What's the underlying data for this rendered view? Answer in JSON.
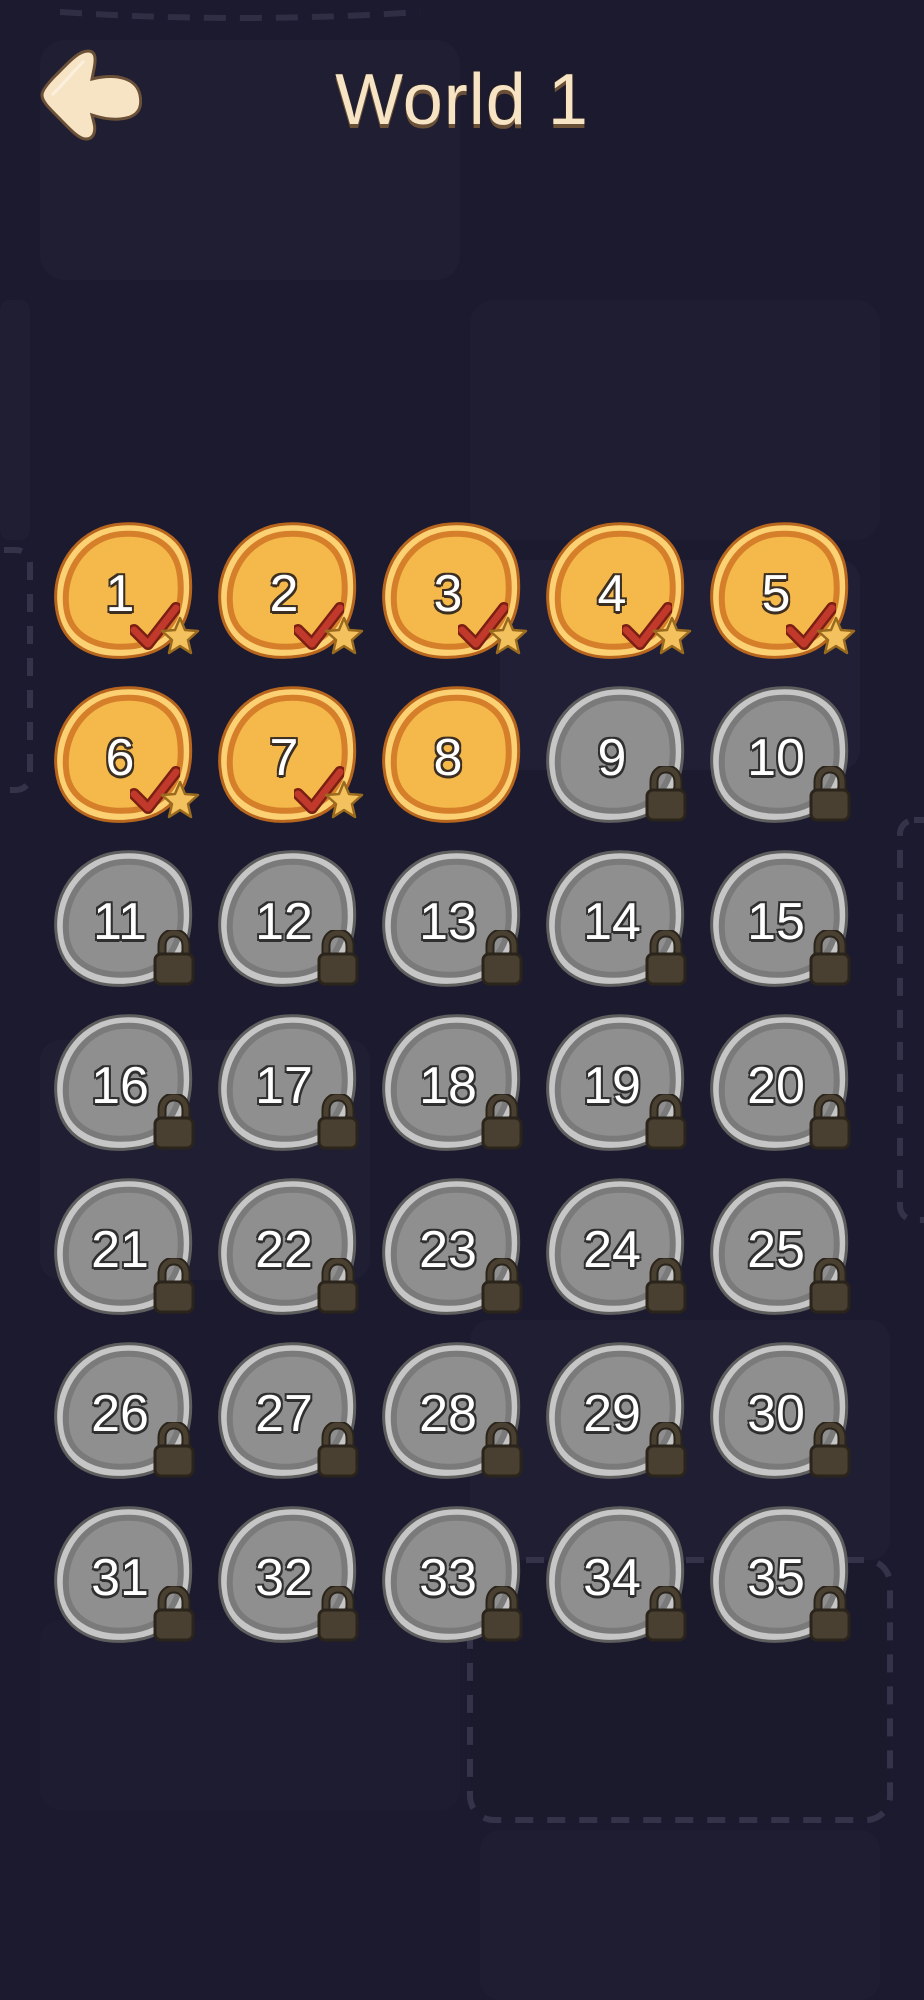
{
  "header": {
    "title": "World 1",
    "back_icon": "back-arrow-icon"
  },
  "colors": {
    "background": "#1b1a2e",
    "unlocked": "#f5b84a",
    "unlocked_rim": "#d67f2a",
    "locked": "#8f8f8f",
    "locked_rim": "#c6c6c6",
    "title": "#f7e4c4",
    "check": "#c0392b",
    "star": "#f3c15d",
    "lock": "#4a4032"
  },
  "levels": [
    {
      "label": "1",
      "state": "completed"
    },
    {
      "label": "2",
      "state": "completed"
    },
    {
      "label": "3",
      "state": "completed"
    },
    {
      "label": "4",
      "state": "completed"
    },
    {
      "label": "5",
      "state": "completed"
    },
    {
      "label": "6",
      "state": "completed"
    },
    {
      "label": "7",
      "state": "completed"
    },
    {
      "label": "8",
      "state": "unlocked"
    },
    {
      "label": "9",
      "state": "locked"
    },
    {
      "label": "10",
      "state": "locked"
    },
    {
      "label": "11",
      "state": "locked"
    },
    {
      "label": "12",
      "state": "locked"
    },
    {
      "label": "13",
      "state": "locked"
    },
    {
      "label": "14",
      "state": "locked"
    },
    {
      "label": "15",
      "state": "locked"
    },
    {
      "label": "16",
      "state": "locked"
    },
    {
      "label": "17",
      "state": "locked"
    },
    {
      "label": "18",
      "state": "locked"
    },
    {
      "label": "19",
      "state": "locked"
    },
    {
      "label": "20",
      "state": "locked"
    },
    {
      "label": "21",
      "state": "locked"
    },
    {
      "label": "22",
      "state": "locked"
    },
    {
      "label": "23",
      "state": "locked"
    },
    {
      "label": "24",
      "state": "locked"
    },
    {
      "label": "25",
      "state": "locked"
    },
    {
      "label": "26",
      "state": "locked"
    },
    {
      "label": "27",
      "state": "locked"
    },
    {
      "label": "28",
      "state": "locked"
    },
    {
      "label": "29",
      "state": "locked"
    },
    {
      "label": "30",
      "state": "locked"
    },
    {
      "label": "31",
      "state": "locked"
    },
    {
      "label": "32",
      "state": "locked"
    },
    {
      "label": "33",
      "state": "locked"
    },
    {
      "label": "34",
      "state": "locked"
    },
    {
      "label": "35",
      "state": "locked"
    }
  ]
}
